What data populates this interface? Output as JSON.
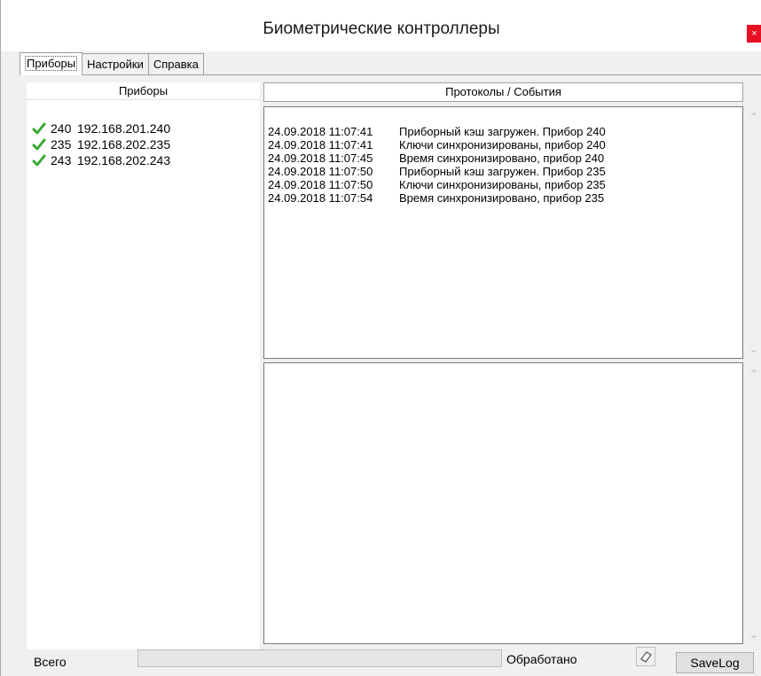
{
  "window": {
    "title": "Биометрические контроллеры",
    "close_label": "×"
  },
  "tabs": [
    {
      "label": "Приборы",
      "active": true
    },
    {
      "label": "Настройки",
      "active": false
    },
    {
      "label": "Справка",
      "active": false
    }
  ],
  "devices": {
    "header": "Приборы",
    "items": [
      {
        "id": "240",
        "ip": "192.168.201.240",
        "status_icon": "green-check-icon"
      },
      {
        "id": "235",
        "ip": "192.168.202.235",
        "status_icon": "green-check-icon"
      },
      {
        "id": "243",
        "ip": "192.168.202.243",
        "status_icon": "green-check-icon"
      }
    ]
  },
  "log": {
    "header": "Протоколы / События",
    "entries": [
      {
        "time": "24.09.2018 11:07:41",
        "message": "Приборный кэш загружен. Прибор 240"
      },
      {
        "time": "24.09.2018 11:07:41",
        "message": "Ключи синхронизированы, прибор 240"
      },
      {
        "time": "24.09.2018 11:07:45",
        "message": "Время синхронизировано, прибор 240"
      },
      {
        "time": "24.09.2018 11:07:50",
        "message": "Приборный кэш загружен. Прибор 235"
      },
      {
        "time": "24.09.2018 11:07:50",
        "message": "Ключи синхронизированы, прибор 235"
      },
      {
        "time": "24.09.2018 11:07:54",
        "message": "Время синхронизировано, прибор 235"
      }
    ]
  },
  "status": {
    "total_label": "Всего",
    "processed_label": "Обработано",
    "progress": 0,
    "clear_icon": "eraser-icon",
    "savelog_label": "SaveLog"
  },
  "colors": {
    "check": "#3aa832",
    "close": "#e81123"
  }
}
